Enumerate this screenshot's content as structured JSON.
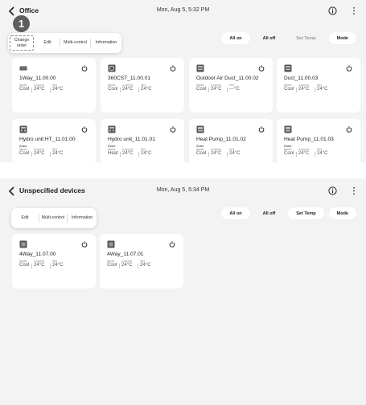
{
  "screens": [
    {
      "title": "Office",
      "datetime": "Mon, Aug 5, 5:32 PM",
      "step_number": "1",
      "actions": [
        {
          "label": "All on",
          "style": "filled"
        },
        {
          "label": "All off",
          "style": "plain"
        },
        {
          "label": "Set Temp",
          "style": "muted"
        },
        {
          "label": "Mode",
          "style": "filled"
        }
      ],
      "menu": [
        "Change order",
        "Edit",
        "Multi-control",
        "Information"
      ],
      "devices": [
        {
          "name": "1Way_11.00.00",
          "icon": "cassette-1way-icon",
          "mode_label": "Mode",
          "current_label": "Current",
          "set_label": "Set",
          "mode": "Cool",
          "current": "24°C",
          "set": "24°C"
        },
        {
          "name": "360CST_11.00.01",
          "icon": "cassette-360-icon",
          "mode_label": "Mode",
          "current_label": "Current",
          "set_label": "Set",
          "mode": "Cool",
          "current": "24°C",
          "set": "24°C"
        },
        {
          "name": "Outdoor Air Duct_11.00.02",
          "icon": "duct-icon",
          "mode_label": "Mode",
          "current_label": "Current",
          "set_label": "Set",
          "mode": "Cool",
          "current": "24°C",
          "set": "---°C"
        },
        {
          "name": "Duct_11.00.03",
          "icon": "duct-icon",
          "mode_label": "Mode",
          "current_label": "Current",
          "set_label": "Set",
          "mode": "Cool",
          "current": "24°C",
          "set": "24°C"
        },
        {
          "name": "Hydro unit HT_11.01.00",
          "icon": "hydro-unit-icon",
          "zone": "Zone",
          "mode_label": "Mode",
          "current_label": "Current",
          "set_label": "Set",
          "mode": "Cool",
          "current": "24°C",
          "set": "24°C"
        },
        {
          "name": "Hydro unit_11.01.01",
          "icon": "hydro-unit-icon",
          "zone": "Zone",
          "mode_label": "Mode",
          "current_label": "Current",
          "set_label": "Set",
          "mode": "Heat",
          "current": "24°C",
          "set": "24°C"
        },
        {
          "name": "Heat Pump_11.01.02",
          "icon": "heat-pump-icon",
          "zone": "Zone",
          "mode_label": "Mode",
          "current_label": "Current",
          "set_label": "Set",
          "mode": "Cool",
          "current": "24°C",
          "set": "24°C"
        },
        {
          "name": "Heat Pump_11.01.03",
          "icon": "heat-pump-icon",
          "zone": "Zone",
          "mode_label": "Mode",
          "current_label": "Current",
          "set_label": "Set",
          "mode": "Cool",
          "current": "24°C",
          "set": "24°C"
        }
      ]
    },
    {
      "title": "Unspecified devices",
      "datetime": "Mon, Aug 5, 5:34 PM",
      "actions": [
        {
          "label": "All on",
          "style": "filled"
        },
        {
          "label": "All off",
          "style": "plain"
        },
        {
          "label": "Set Temp",
          "style": "filled"
        },
        {
          "label": "Mode",
          "style": "filled"
        }
      ],
      "menu": [
        "Edit",
        "Multi-control",
        "Information"
      ],
      "devices": [
        {
          "name": "4Way_11.07.00",
          "icon": "cassette-4way-icon",
          "mode_label": "Mode",
          "current_label": "Current",
          "set_label": "Set",
          "mode": "Cool",
          "current": "24°C",
          "set": "24°C"
        },
        {
          "name": "4Way_11.07.01",
          "icon": "cassette-4way-icon",
          "mode_label": "Mode",
          "current_label": "Current",
          "set_label": "Set",
          "mode": "Cool",
          "current": "24°C",
          "set": "24°C"
        }
      ]
    }
  ]
}
